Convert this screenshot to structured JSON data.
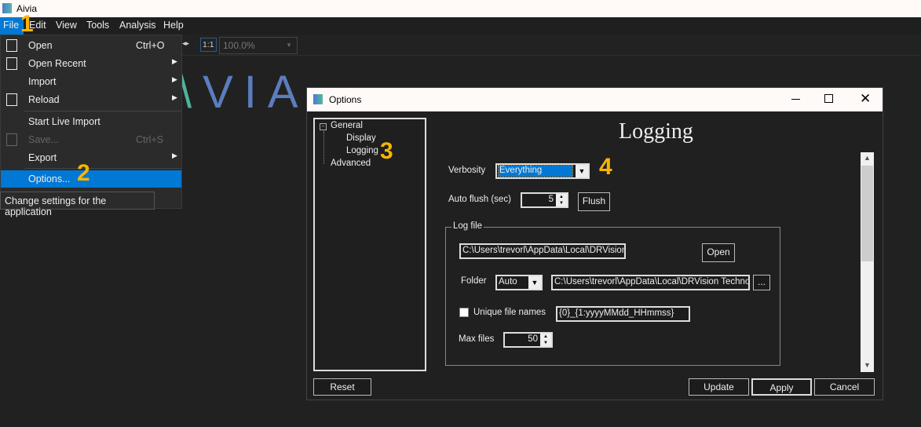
{
  "app": {
    "title": "Aivia",
    "logo_text": "VIA"
  },
  "menubar": [
    "File",
    "Edit",
    "View",
    "Tools",
    "Analysis",
    "Help"
  ],
  "toolbar": {
    "ratio": "1:1",
    "zoom": "100.0%"
  },
  "file_menu": [
    {
      "label": "Open",
      "shortcut": "Ctrl+O",
      "icon": "file-icon"
    },
    {
      "label": "Open Recent",
      "icon": "recent-icon",
      "submenu": true
    },
    {
      "label": "Import",
      "submenu": true
    },
    {
      "label": "Reload",
      "icon": "reload-icon",
      "submenu": true
    },
    {
      "label": "Start Live Import"
    },
    {
      "label": "Save...",
      "shortcut": "Ctrl+S",
      "icon": "save-icon",
      "disabled": true
    },
    {
      "label": "Export",
      "submenu": true
    },
    {
      "label": "Options...",
      "highlighted": true
    }
  ],
  "tooltip": "Change settings for the application",
  "annotations": [
    "1",
    "2",
    "3",
    "4"
  ],
  "dialog": {
    "title": "Options",
    "tree": [
      {
        "label": "General"
      },
      {
        "label": "Display"
      },
      {
        "label": "Logging"
      },
      {
        "label": "Advanced"
      }
    ],
    "heading": "Logging",
    "verbosity_label": "Verbosity",
    "verbosity_value": "Everything",
    "autoflush_label": "Auto flush (sec)",
    "autoflush_value": "5",
    "flush_button": "Flush",
    "logfile_group": "Log file",
    "logfile_path": "C:\\Users\\trevorl\\AppData\\Local\\DRVision Technologies LLC\\",
    "open_button": "Open",
    "folder_label": "Folder",
    "folder_mode": "Auto",
    "folder_path": "C:\\Users\\trevorl\\AppData\\Local\\DRVision Technol",
    "browse_button": "...",
    "unique_label": "Unique file names",
    "unique_checked": false,
    "unique_pattern": "{0}_{1:yyyyMMdd_HHmmss}",
    "maxfiles_label": "Max files",
    "maxfiles_value": "50",
    "reset_button": "Reset",
    "update_button": "Update",
    "apply_button": "Apply",
    "cancel_button": "Cancel"
  },
  "colors": {
    "accent": "#0078d4",
    "annotation": "#f7b500",
    "logo": "#5b7dbd"
  }
}
